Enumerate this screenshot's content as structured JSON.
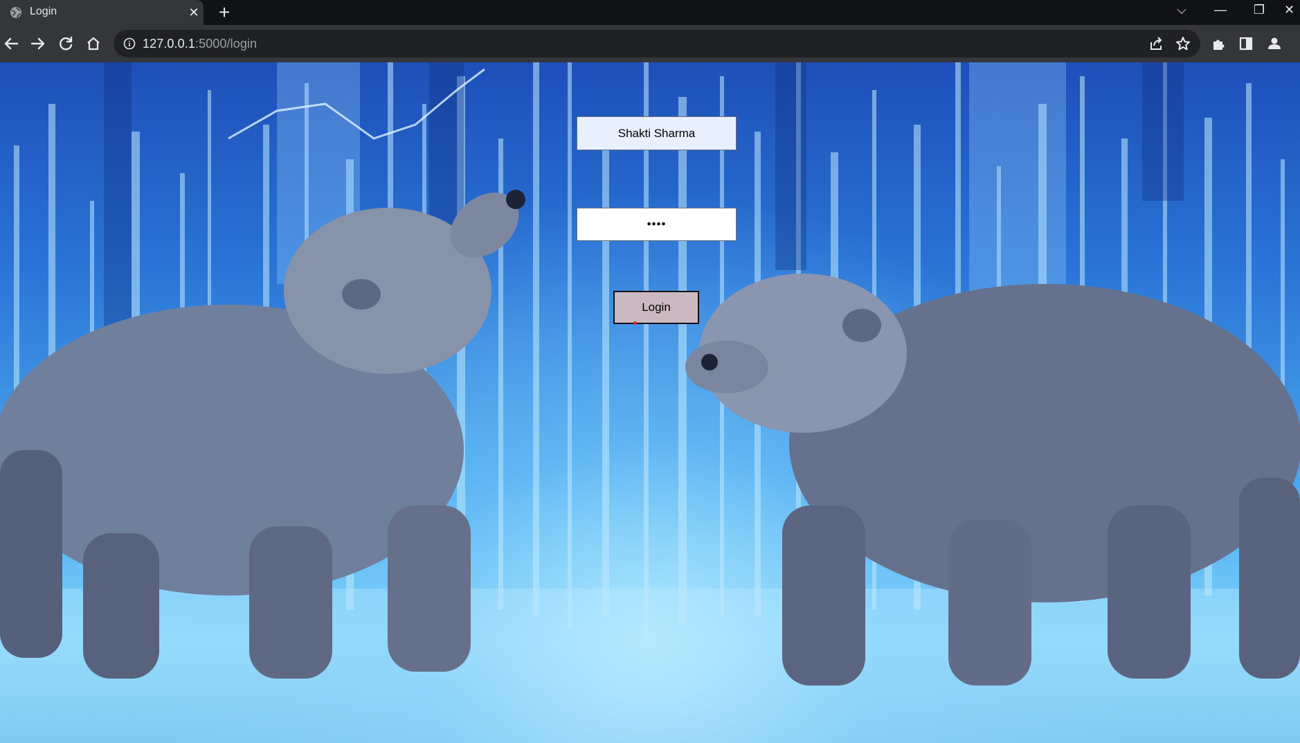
{
  "browser": {
    "tab_title": "Login",
    "close_glyph": "✕",
    "new_tab_glyph": "+",
    "url_host": "127.0.0.1",
    "url_rest": ":5000/login",
    "window_controls": {
      "menu": "⌵",
      "minimize": "—",
      "restore": "❐",
      "close": "✕"
    }
  },
  "icons": [
    "globe-icon",
    "close-icon",
    "plus-icon",
    "back-arrow-icon",
    "forward-arrow-icon",
    "reload-icon",
    "home-icon",
    "info-icon",
    "share-icon",
    "star-icon",
    "extensions-icon",
    "side-panel-icon",
    "profile-icon"
  ],
  "login_form": {
    "username_value": "Shakti Sharma",
    "password_value": "••••",
    "login_label": "Login"
  },
  "colors": {
    "accent_background": "#2a74d6",
    "username_fill": "#e8f0fe",
    "button_fill": "#cbb9c2"
  }
}
